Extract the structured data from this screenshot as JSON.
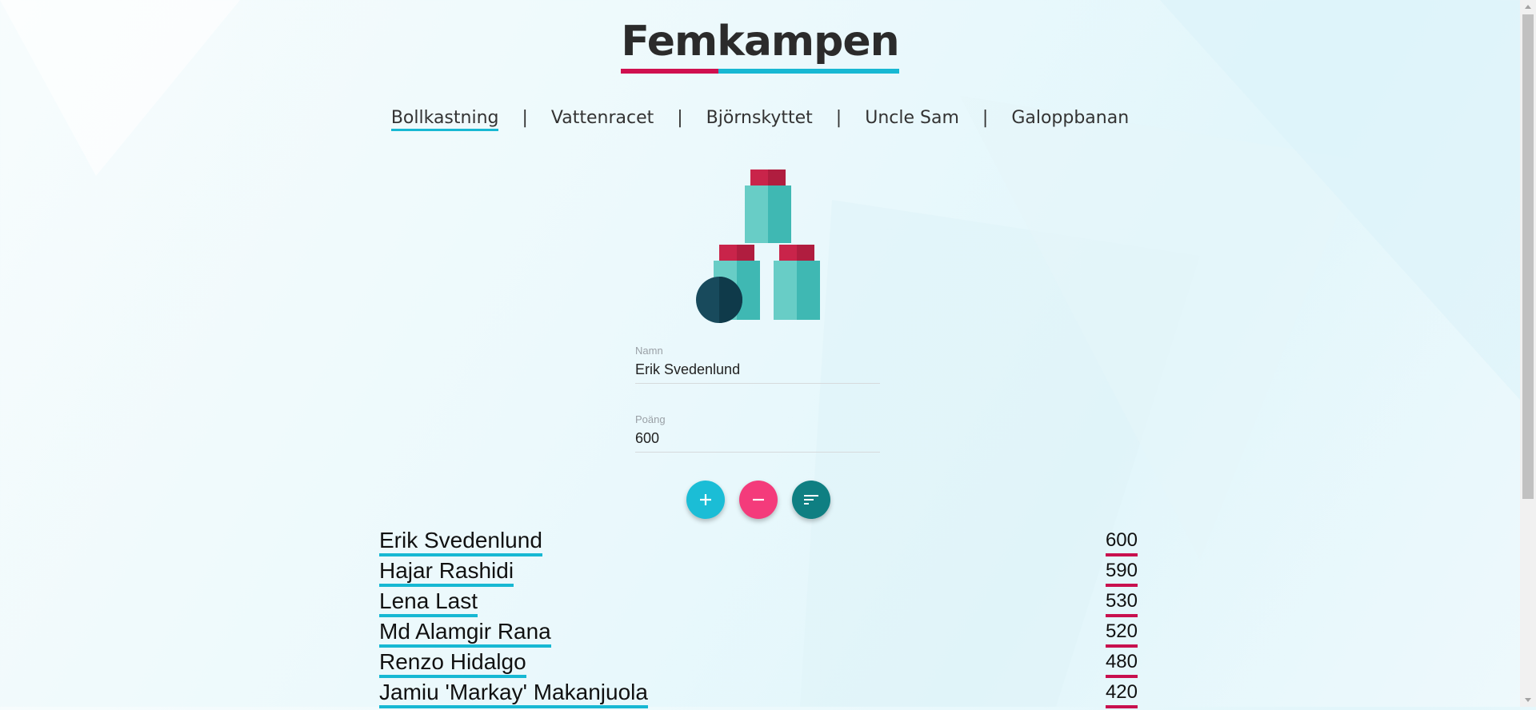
{
  "app": {
    "title": "Femkampen"
  },
  "nav": {
    "items": [
      {
        "label": "Bollkastning",
        "active": true
      },
      {
        "label": "Vattenracet",
        "active": false
      },
      {
        "label": "Björnskyttet",
        "active": false
      },
      {
        "label": "Uncle Sam",
        "active": false
      },
      {
        "label": "Galoppbanan",
        "active": false
      }
    ]
  },
  "form": {
    "name_label": "Namn",
    "name_value": "Erik Svedenlund",
    "score_label": "Poäng",
    "score_value": "600"
  },
  "actions": {
    "add_icon": "plus-icon",
    "remove_icon": "minus-icon",
    "sort_icon": "sort-icon"
  },
  "colors": {
    "accent_cyan": "#17b8d3",
    "accent_pink": "#d0104f",
    "fab_add": "#1bbdd6",
    "fab_remove": "#f43b7b",
    "fab_sort": "#0f7f82"
  },
  "scores": [
    {
      "name": "Erik Svedenlund",
      "score": "600"
    },
    {
      "name": "Hajar Rashidi",
      "score": "590"
    },
    {
      "name": "Lena Last",
      "score": "530"
    },
    {
      "name": "Md Alamgir Rana",
      "score": "520"
    },
    {
      "name": "Renzo Hidalgo",
      "score": "480"
    },
    {
      "name": "Jamiu 'Markay' Makanjuola",
      "score": "420"
    }
  ]
}
